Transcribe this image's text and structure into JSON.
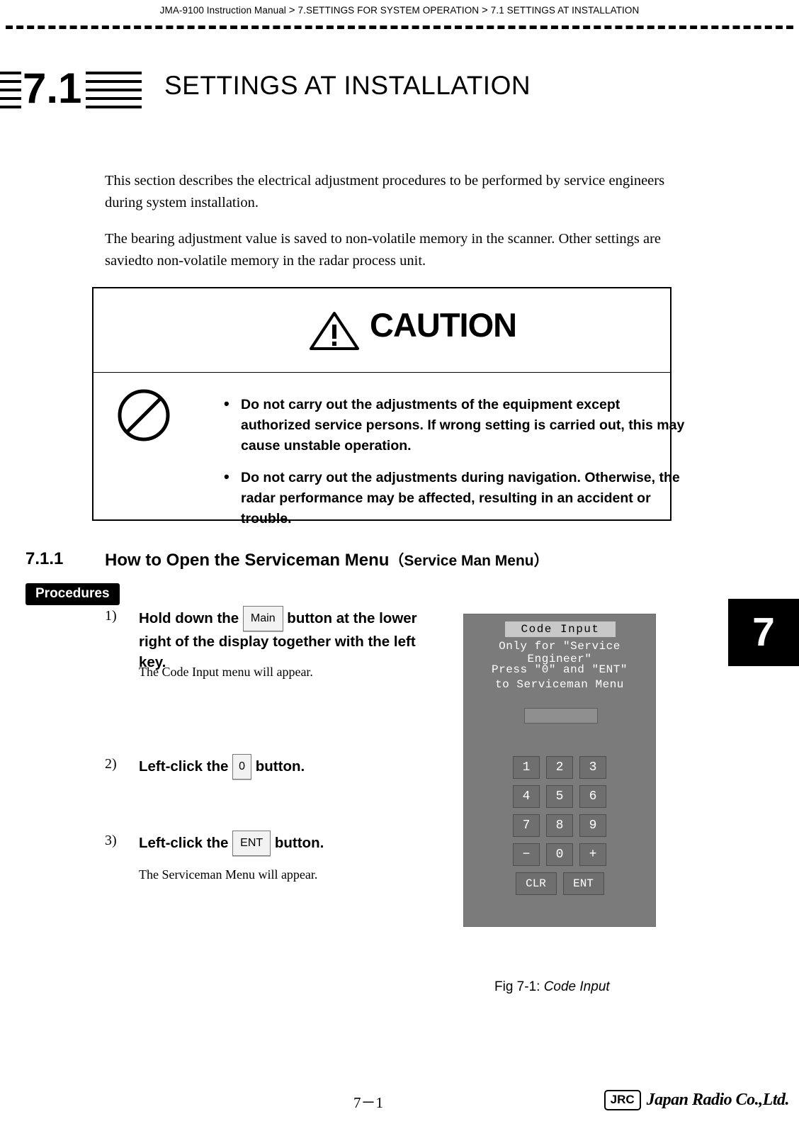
{
  "header": {
    "manual": "JMA-9100 Instruction Manual",
    "sep1": ">",
    "crumb1": "7.SETTINGS FOR SYSTEM OPERATION",
    "sep2": ">",
    "crumb2": "7.1  SETTINGS AT INSTALLATION"
  },
  "section": {
    "number": "7.1",
    "title": "SETTINGS AT INSTALLATION"
  },
  "body": {
    "para1": "This section describes the electrical adjustment procedures to be performed by service engineers during system installation.",
    "para2": "The bearing adjustment value is saved to non-volatile memory in the scanner. Other settings are saviedto non-volatile memory in the radar process unit."
  },
  "caution": {
    "word": "CAUTION",
    "items": [
      "Do not carry out the adjustments of the equipment except authorized service persons. If wrong setting is carried out, this may cause unstable operation.",
      "Do not carry out the adjustments during navigation. Otherwise, the radar performance may be affected, resulting in an accident or trouble."
    ]
  },
  "subsection": {
    "number": "7.1.1",
    "title_main": "How to Open the Serviceman Menu",
    "title_paren": "（Service Man Menu）"
  },
  "procedures": {
    "tag": "Procedures",
    "steps": [
      {
        "num": "1)",
        "text_before": "Hold down the",
        "key": "Main",
        "text_after": "button at the lower right of the display together with the left key.",
        "note": "The Code Input menu will appear."
      },
      {
        "num": "2)",
        "text_before": "Left-click the",
        "key": "0",
        "text_after": "button.",
        "note": ""
      },
      {
        "num": "3)",
        "text_before": "Left-click the",
        "key": "ENT",
        "text_after": "button.",
        "note": "The Serviceman Menu will appear."
      }
    ]
  },
  "figure": {
    "title": "Code Input",
    "subtitle": "Only for \"Service Engineer\"",
    "press_line1": "Press \"0\" and \"ENT\"",
    "press_line2": "to Serviceman Menu",
    "input_value": "",
    "keys": [
      [
        "1",
        "2",
        "3"
      ],
      [
        "4",
        "5",
        "6"
      ],
      [
        "7",
        "8",
        "9"
      ],
      [
        "−",
        "0",
        "+"
      ],
      [
        "CLR",
        "ENT"
      ]
    ],
    "caption_label": "Fig 7-1:",
    "caption_text": "Code Input"
  },
  "chapter_tab": "7",
  "footer": {
    "page": "7－1",
    "logo_box": "JRC",
    "logo_name": "Japan Radio Co.,Ltd."
  }
}
